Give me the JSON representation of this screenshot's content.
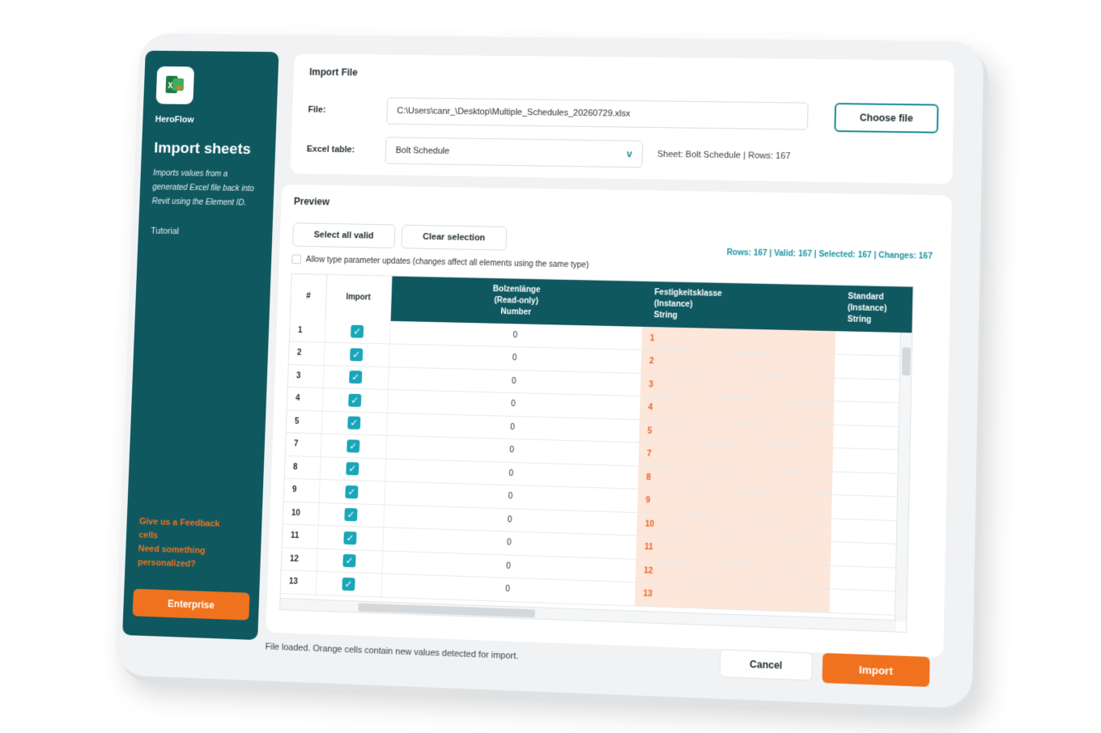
{
  "sidebar": {
    "app_name": "HeroFlow",
    "title": "Import sheets",
    "description": "Imports values from a generated Excel file back into Revit using the Element ID.",
    "tutorial_link": "Tutorial",
    "feedback_line1": "Give us a Feedback",
    "feedback_line2": "cells",
    "personalized_line1": "Need something",
    "personalized_line2": "personalized?",
    "enterprise_label": "Enterprise"
  },
  "import_file": {
    "title": "Import File",
    "file_label": "File:",
    "file_value": "C:\\Users\\canr_\\Desktop\\Multiple_Schedules_20260729.xlsx",
    "choose_label": "Choose file",
    "table_label": "Excel table:",
    "table_value": "Bolt Schedule",
    "sheet_info": "Sheet: Bolt Schedule | Rows: 167"
  },
  "preview": {
    "title": "Preview",
    "select_all_label": "Select all valid",
    "clear_label": "Clear selection",
    "stats": "Rows: 167 | Valid: 167 | Selected: 167 | Changes: 167",
    "allow_type_label": "Allow type parameter updates (changes affect all elements using the same type)",
    "columns": {
      "index": "#",
      "import": "Import",
      "bolzen_l1": "Bolzenlänge",
      "bolzen_l2": "(Read-only)",
      "bolzen_l3": "Number",
      "festig_l1": "Festigkeitsklasse",
      "festig_l2": "(Instance)",
      "festig_l3": "String",
      "standard_l1": "Standard",
      "standard_l2": "(Instance)",
      "standard_l3": "String"
    },
    "rows": [
      {
        "id": "1",
        "bolzen": "0",
        "festig": "1"
      },
      {
        "id": "2",
        "bolzen": "0",
        "festig": "2"
      },
      {
        "id": "3",
        "bolzen": "0",
        "festig": "3"
      },
      {
        "id": "4",
        "bolzen": "0",
        "festig": "4"
      },
      {
        "id": "5",
        "bolzen": "0",
        "festig": "5"
      },
      {
        "id": "7",
        "bolzen": "0",
        "festig": "7"
      },
      {
        "id": "8",
        "bolzen": "0",
        "festig": "8"
      },
      {
        "id": "9",
        "bolzen": "0",
        "festig": "9"
      },
      {
        "id": "10",
        "bolzen": "0",
        "festig": "10"
      },
      {
        "id": "11",
        "bolzen": "0",
        "festig": "11"
      },
      {
        "id": "12",
        "bolzen": "0",
        "festig": "12"
      },
      {
        "id": "13",
        "bolzen": "0",
        "festig": "13"
      }
    ]
  },
  "footer": {
    "status": "File loaded. Orange cells contain new values detected for import.",
    "cancel_label": "Cancel",
    "import_label": "Import"
  },
  "colors": {
    "sidebar_bg": "#0f5860",
    "accent_orange": "#f0721e",
    "accent_teal": "#1aa6b8",
    "changed_cell_bg": "#fde6da"
  },
  "icons": {
    "logo": "excel-import-icon",
    "dropdown": "chevron-down-icon",
    "check": "checkmark-icon"
  }
}
